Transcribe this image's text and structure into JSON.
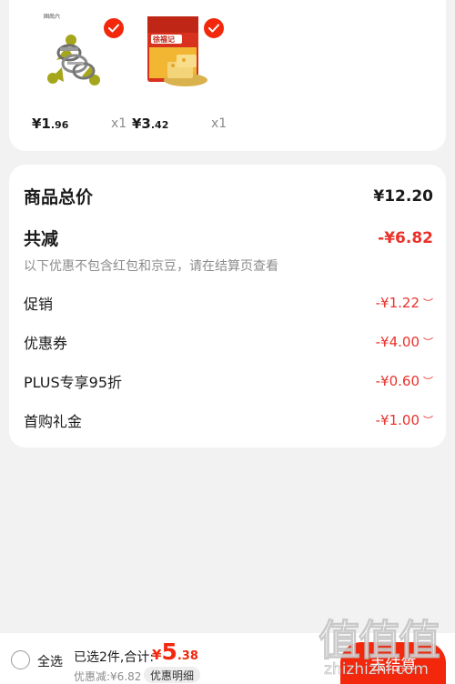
{
  "products": [
    {
      "name": "metal-clamp-product",
      "brand_text": "固尚六",
      "price_int": "¥1",
      "price_dec": ".96",
      "qty": "x1",
      "selected": true
    },
    {
      "name": "snack-pastry-product",
      "brand_text": "徐福记",
      "price_int": "¥3",
      "price_dec": ".42",
      "qty": "x1",
      "selected": true
    }
  ],
  "summary": {
    "total_label": "商品总价",
    "total_value": "¥12.20",
    "reduce_label": "共减",
    "reduce_value": "-¥6.82",
    "note": "以下优惠不包含红包和京豆，请在结算页查看",
    "discounts": [
      {
        "label": "促销",
        "value": "-¥1.22"
      },
      {
        "label": "优惠券",
        "value": "-¥4.00"
      },
      {
        "label": "PLUS专享95折",
        "value": "-¥0.60"
      },
      {
        "label": "首购礼金",
        "value": "-¥1.00"
      }
    ]
  },
  "bottom_bar": {
    "select_all": "全选",
    "selected_info": "已选2件,合计:",
    "total_yen": "¥",
    "total_int": "5",
    "total_dec": ".38",
    "savings": "优惠减:¥6.82",
    "detail_button": "优惠明细",
    "checkout_button": "去结算"
  },
  "watermark": {
    "logo": "值值值",
    "url": "zhizhizhi.com"
  },
  "colors": {
    "accent": "#f2270c",
    "discount": "#e8322b",
    "muted": "#8c8c8c",
    "background": "#f2f2f2"
  },
  "icons": [
    "check-icon",
    "chevron-down-icon",
    "radio-icon"
  ]
}
